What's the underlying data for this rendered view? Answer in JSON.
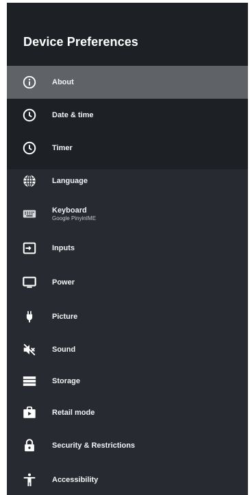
{
  "header": {
    "title": "Device Preferences"
  },
  "menu": [
    {
      "label": "About",
      "sub": "",
      "icon": "info-icon"
    },
    {
      "label": "Date & time",
      "sub": "",
      "icon": "clock-icon"
    },
    {
      "label": "Timer",
      "sub": "",
      "icon": "timer-icon"
    },
    {
      "label": "Language",
      "sub": "",
      "icon": "globe-icon"
    },
    {
      "label": "Keyboard",
      "sub": "Google PinyinIME",
      "icon": "keyboard-icon"
    },
    {
      "label": "Inputs",
      "sub": "",
      "icon": "input-icon"
    },
    {
      "label": "Power",
      "sub": "",
      "icon": "monitor-icon"
    },
    {
      "label": "Picture",
      "sub": "",
      "icon": "plug-icon"
    },
    {
      "label": "Sound",
      "sub": "",
      "icon": "mute-icon"
    },
    {
      "label": "Storage",
      "sub": "",
      "icon": "storage-icon"
    },
    {
      "label": "Retail mode",
      "sub": "",
      "icon": "retail-icon"
    },
    {
      "label": "Security & Restrictions",
      "sub": "",
      "icon": "lock-icon"
    },
    {
      "label": "Accessibility",
      "sub": "",
      "icon": "accessibility-icon"
    }
  ],
  "colors": {
    "panel": "#272a31",
    "panel_top": "#1d2025",
    "selected": "#5f6368",
    "text": "#f1f3f4"
  }
}
